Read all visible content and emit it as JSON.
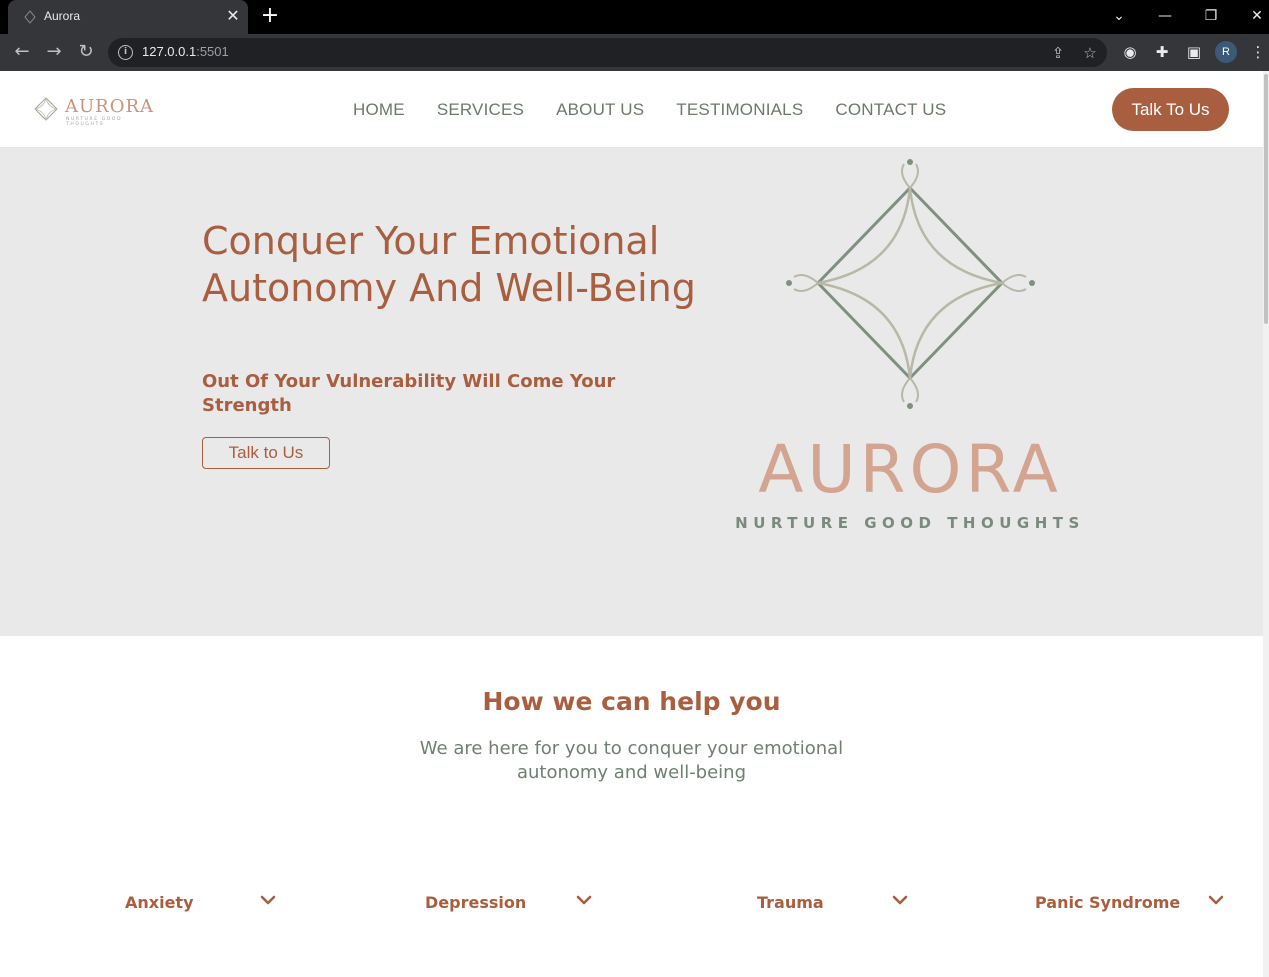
{
  "browser": {
    "tab_title": "Aurora",
    "url_host": "127.0.0.1",
    "url_port": ":5501",
    "profile_initial": "R"
  },
  "header": {
    "logo_word": "AURORA",
    "logo_tagline": "NURTURE GOOD THOUGHTS",
    "nav": [
      "HOME",
      "SERVICES",
      "ABOUT US",
      "TESTIMONIALS",
      "CONTACT US"
    ],
    "cta_label": "Talk To Us"
  },
  "hero": {
    "title": "Conquer Your Emotional Autonomy And Well-Being",
    "subtitle": "Out Of Your Vulnerability Will Come Your Strength",
    "button_label": "Talk to Us",
    "brand_word": "AURORA",
    "brand_tagline": "NURTURE GOOD THOUGHTS"
  },
  "help": {
    "title": "How we can help you",
    "subtitle": "We are here for you to conquer your emotional autonomy and well-being",
    "items": [
      {
        "label": "Anxiety",
        "icon": "chevron-down-icon"
      },
      {
        "label": "Depression",
        "icon": "chevron-down-icon"
      },
      {
        "label": "Trauma",
        "icon": "chevron-down-icon"
      },
      {
        "label": "Panic Syndrome",
        "icon": "chevron-down-icon"
      }
    ]
  },
  "colors": {
    "brand": "#a95e3f",
    "sage": "#6b7a6b",
    "blush": "#d3a590",
    "hero_bg": "#e9e9e9"
  }
}
